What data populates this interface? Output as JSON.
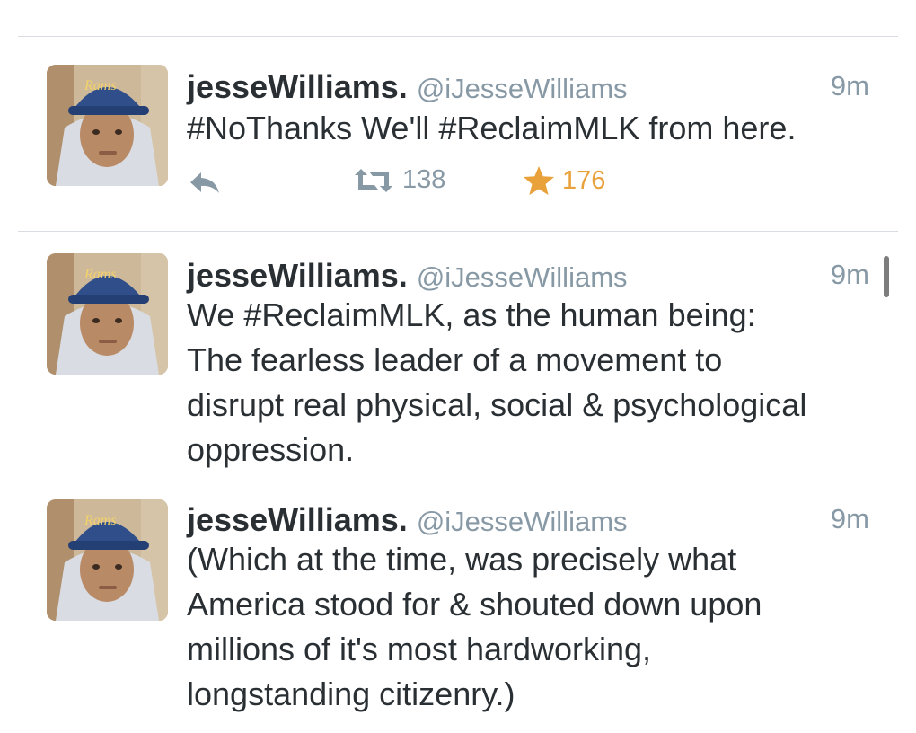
{
  "tweets": [
    {
      "display_name": "jesseWilliams.",
      "handle": "@iJesseWilliams",
      "time": "9m",
      "lines": [
        "#NoThanks We'll #ReclaimMLK from here."
      ],
      "retweets": "138",
      "favorites": "176"
    },
    {
      "display_name": "jesseWilliams.",
      "handle": "@iJesseWilliams",
      "time": "9m",
      "lines": [
        "We #ReclaimMLK, as the human being:",
        "The fearless leader of a movement to",
        "disrupt real physical, social & psychological",
        "oppression."
      ]
    },
    {
      "display_name": "jesseWilliams.",
      "handle": "@iJesseWilliams",
      "time": "9m",
      "lines": [
        "(Which at the time, was precisely what",
        "America stood for & shouted down upon",
        "millions of it's most hardworking,",
        "longstanding citizenry.)"
      ]
    }
  ],
  "icons": {
    "reply": "reply-icon",
    "retweet": "retweet-icon",
    "favorite": "star-icon"
  },
  "colors": {
    "text": "#292f33",
    "secondary": "#8899a6",
    "favorite": "#e9a23b",
    "divider": "#d9dde1"
  }
}
